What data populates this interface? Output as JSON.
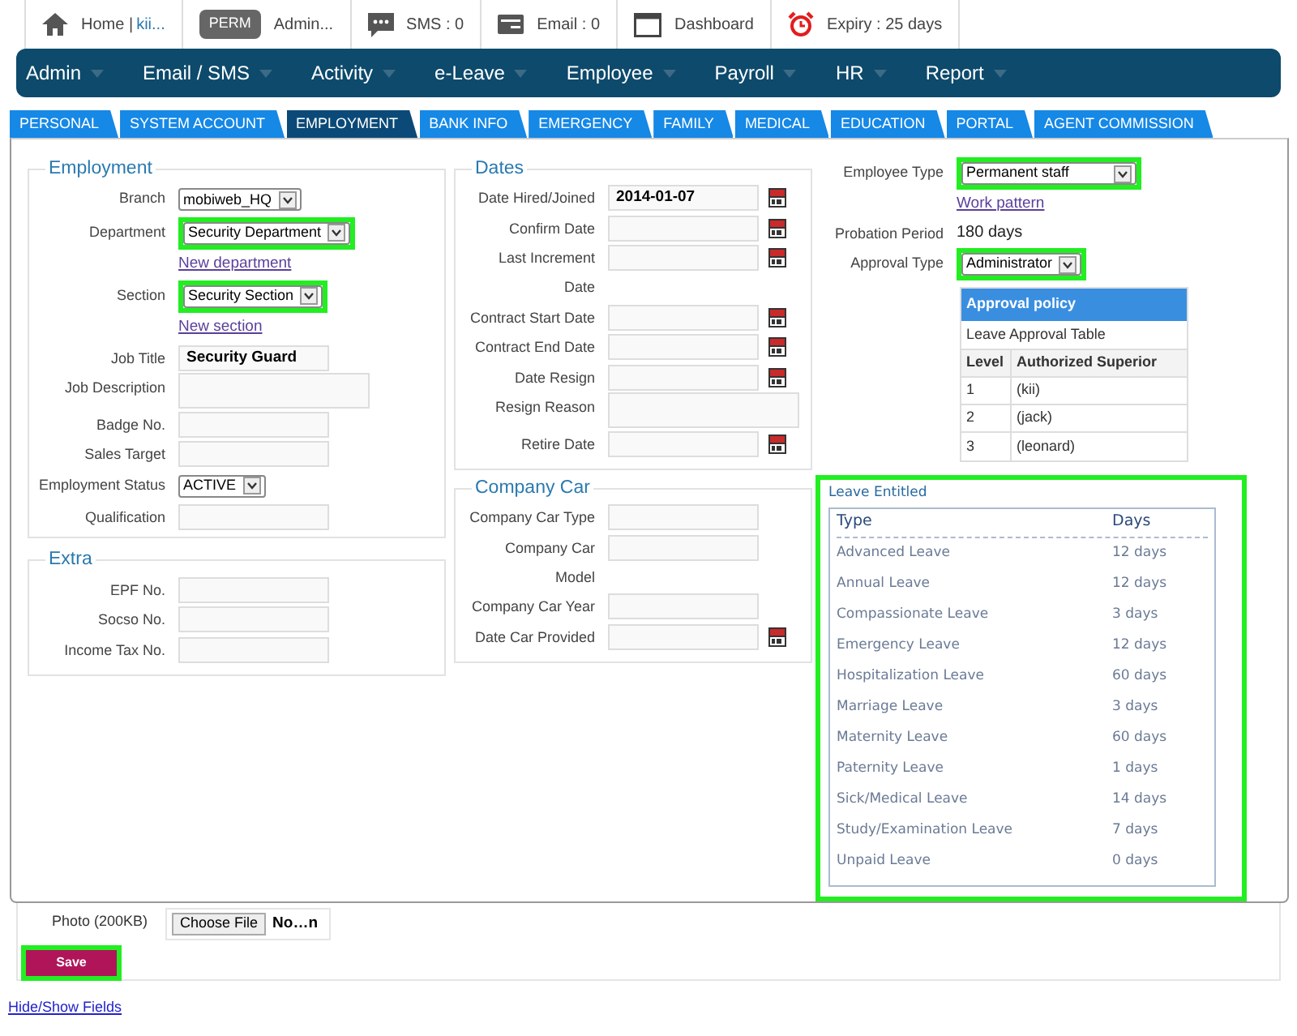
{
  "topbar": {
    "items": [
      {
        "kind": "home",
        "label": "Home |",
        "user": "kii..."
      },
      {
        "kind": "badge",
        "badge": "PERM",
        "label": "Admin..."
      },
      {
        "kind": "sms",
        "label": "SMS : 0"
      },
      {
        "kind": "email",
        "label": "Email : 0"
      },
      {
        "kind": "dashboard",
        "label": "Dashboard"
      },
      {
        "kind": "expiry",
        "label": "Expiry : 25 days"
      }
    ]
  },
  "menu": [
    "Admin",
    "Email / SMS",
    "Activity",
    "e-Leave",
    "Employee",
    "Payroll",
    "HR",
    "Report"
  ],
  "tabs": [
    {
      "label": "PERSONAL",
      "selected": false
    },
    {
      "label": "SYSTEM ACCOUNT",
      "selected": false
    },
    {
      "label": "EMPLOYMENT",
      "selected": true
    },
    {
      "label": "BANK INFO",
      "selected": false
    },
    {
      "label": "EMERGENCY",
      "selected": false
    },
    {
      "label": "FAMILY",
      "selected": false
    },
    {
      "label": "MEDICAL",
      "selected": false
    },
    {
      "label": "EDUCATION",
      "selected": false
    },
    {
      "label": "PORTAL",
      "selected": false
    },
    {
      "label": "AGENT COMMISSION",
      "selected": false
    }
  ],
  "employment": {
    "title": "Employment",
    "fields": [
      {
        "kind": "select",
        "label": "Branch",
        "value": "mobiweb_HQ",
        "highlighted": false
      },
      {
        "kind": "select",
        "label": "Department",
        "value": "Security Department",
        "highlighted": true
      },
      {
        "kind": "link",
        "value": "New department"
      },
      {
        "kind": "select",
        "label": "Section",
        "value": "Security Section",
        "highlighted": true
      },
      {
        "kind": "link",
        "value": "New section"
      },
      {
        "kind": "input",
        "label": "Job Title",
        "value": "Security Guard"
      },
      {
        "kind": "textarea",
        "label": "Job Description"
      },
      {
        "kind": "input",
        "label": "Badge No."
      },
      {
        "kind": "input",
        "label": "Sales Target"
      },
      {
        "kind": "select",
        "label": "Employment Status",
        "value": "ACTIVE",
        "highlighted": false
      },
      {
        "kind": "input",
        "label": "Qualification"
      }
    ]
  },
  "extra": {
    "title": "Extra",
    "fields": [
      {
        "kind": "input",
        "label": "EPF No."
      },
      {
        "kind": "input",
        "label": "Socso No."
      },
      {
        "kind": "input",
        "label": "Income Tax No."
      }
    ]
  },
  "dates": {
    "title": "Dates",
    "fields": [
      {
        "kind": "date",
        "label": "Date Hired/Joined",
        "value": "2014-01-07"
      },
      {
        "kind": "date",
        "label": "Confirm Date"
      },
      {
        "kind": "date",
        "label": "Last Increment\nDate"
      },
      {
        "kind": "date",
        "label": "Contract Start Date"
      },
      {
        "kind": "date",
        "label": "Contract End Date"
      },
      {
        "kind": "date",
        "label": "Date Resign"
      },
      {
        "kind": "textarea",
        "label": "Resign Reason"
      },
      {
        "kind": "date",
        "label": "Retire Date"
      }
    ]
  },
  "company_car": {
    "title": "Company Car",
    "fields": [
      {
        "kind": "input",
        "label": "Company Car Type"
      },
      {
        "kind": "input",
        "label": "Company Car\nModel"
      },
      {
        "kind": "input",
        "label": "Company Car Year"
      },
      {
        "kind": "date",
        "label": "Date Car Provided"
      }
    ]
  },
  "right": {
    "fields": [
      {
        "kind": "select",
        "label": "Employee Type",
        "value": "Permanent staff",
        "highlighted": true
      },
      {
        "kind": "link",
        "value": "Work pattern"
      },
      {
        "kind": "text",
        "label": "Probation Period",
        "value": "180 days"
      },
      {
        "kind": "select",
        "label": "Approval Type",
        "value": "Administrator",
        "highlighted": true
      }
    ]
  },
  "approval_policy": {
    "title": "Approval policy",
    "subtitle": "Leave Approval Table",
    "columns": [
      "Level",
      "Authorized Superior"
    ],
    "rows": [
      [
        "1",
        "(kii)"
      ],
      [
        "2",
        "(jack)"
      ],
      [
        "3",
        "(leonard)"
      ]
    ]
  },
  "leave_entitled": {
    "title": "Leave Entitled",
    "highlighted": true,
    "columns": [
      "Type",
      "Days"
    ],
    "rows": [
      [
        "Advanced Leave",
        "12 days"
      ],
      [
        "Annual Leave",
        "12 days"
      ],
      [
        "Compassionate Leave",
        "3 days"
      ],
      [
        "Emergency Leave",
        "12 days"
      ],
      [
        "Hospitalization Leave",
        "60 days"
      ],
      [
        "Marriage Leave",
        "3 days"
      ],
      [
        "Maternity Leave",
        "60 days"
      ],
      [
        "Paternity Leave",
        "1 days"
      ],
      [
        "Sick/Medical Leave",
        "14 days"
      ],
      [
        "Study/Examination Leave",
        "7 days"
      ],
      [
        "Unpaid Leave",
        "0 days"
      ]
    ]
  },
  "photo": {
    "label": "Photo (200KB)",
    "button": "Choose File",
    "file": "No…n"
  },
  "save": {
    "label": "Save",
    "highlighted": true
  },
  "footer_link": "Hide/Show Fields"
}
